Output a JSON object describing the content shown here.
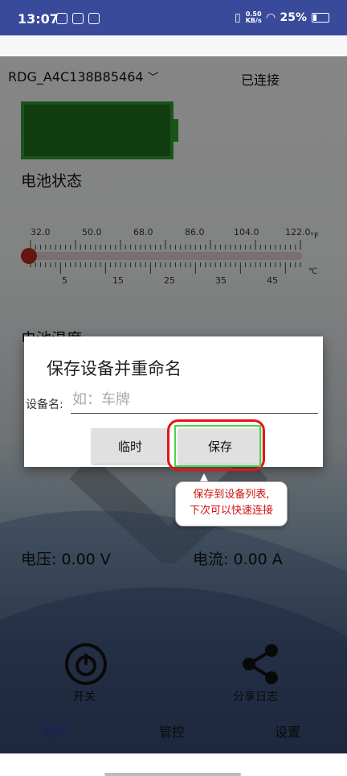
{
  "status_bar": {
    "time": "13:07",
    "net_speed": "0.50\nKB/s",
    "battery": "25%"
  },
  "device": {
    "name": "RDG_A4C138B85464",
    "connection": "已连接"
  },
  "battery_section": {
    "title": "电池状态"
  },
  "thermometer": {
    "fahrenheit_ticks": [
      "32.0",
      "50.0",
      "68.0",
      "86.0",
      "104.0",
      "122.0"
    ],
    "fahrenheit_unit": "°F",
    "celsius_ticks": [
      "5",
      "15",
      "25",
      "35",
      "45"
    ],
    "celsius_unit": "℃"
  },
  "temp_section": {
    "title": "电池温度"
  },
  "dialog": {
    "title": "保存设备并重命名",
    "field_label": "设备名:",
    "field_placeholder": "如：车牌",
    "field_value": "",
    "temp_button": "临时",
    "save_button": "保存"
  },
  "tooltip": {
    "line1": "保存到设备列表,",
    "line2": "下次可以快速连接"
  },
  "readouts": {
    "voltage": "电压: 0.00 V",
    "current": "电流: 0.00 A"
  },
  "controls": {
    "power_label": "开关",
    "share_label": "分享日志"
  },
  "tabs": {
    "home": "首页",
    "control": "管控",
    "settings": "设置"
  },
  "colors": {
    "accent": "#2f3ba8",
    "battery_green": "#2e9b31",
    "highlight_red": "#e11616"
  }
}
